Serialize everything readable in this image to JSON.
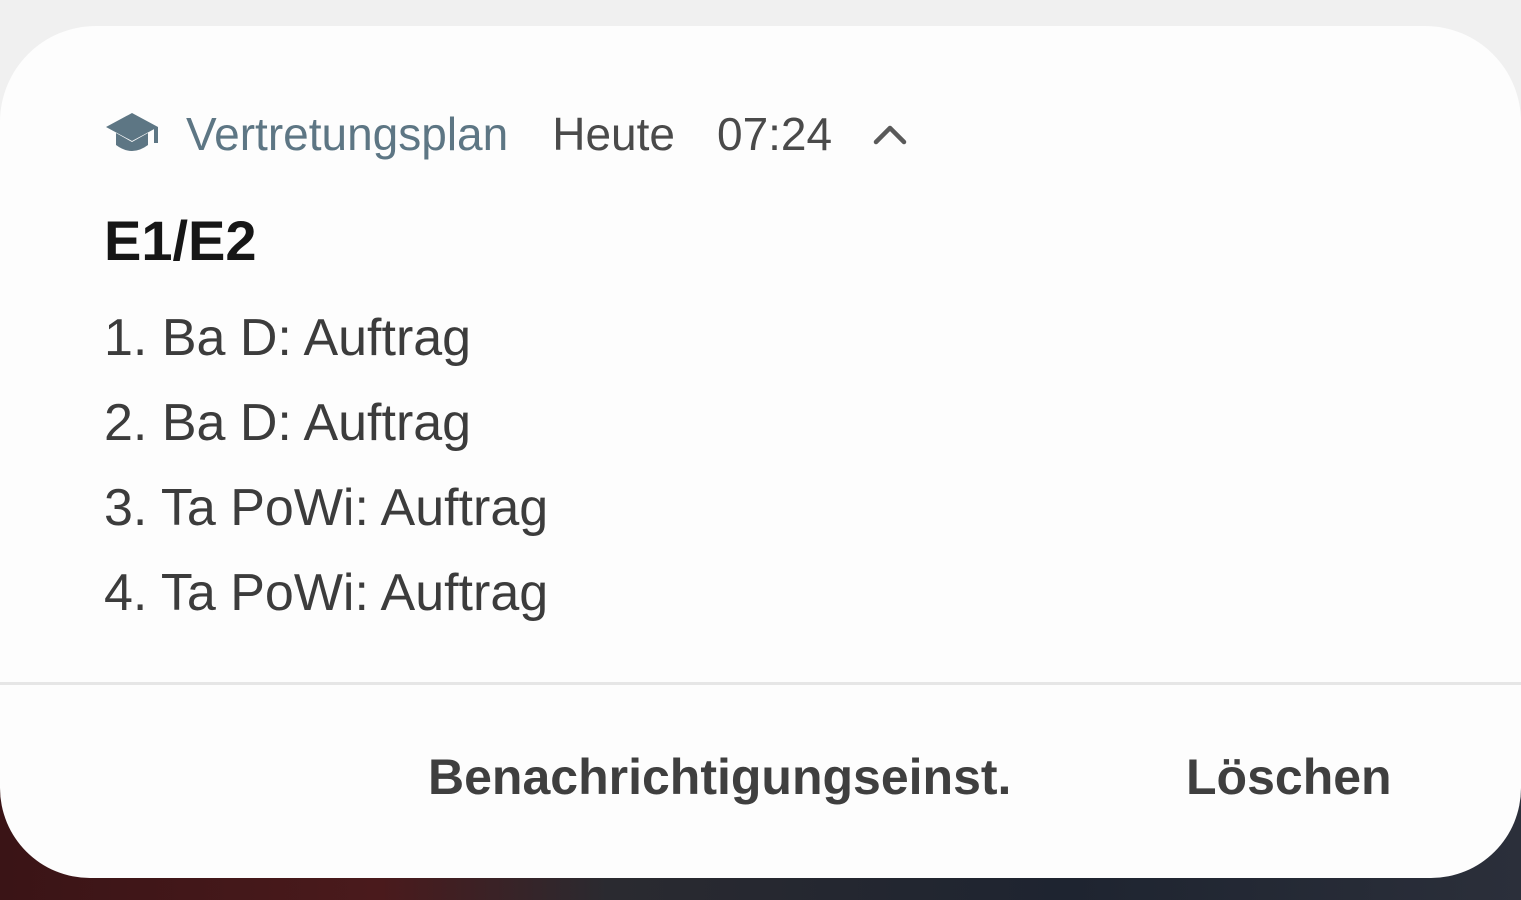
{
  "notification": {
    "app_icon": "graduation-cap-icon",
    "app_name": "Vertretungsplan",
    "when": "Heute",
    "time": "07:24",
    "expand_icon": "chevron-up-icon",
    "title": "E1/E2",
    "lines": [
      "1. Ba D: Auftrag",
      "2. Ba D: Auftrag",
      "3. Ta PoWi: Auftrag",
      "4. Ta PoWi: Auftrag"
    ],
    "actions": {
      "settings_label": "Benachrichtigungseinst.",
      "clear_label": "Löschen"
    }
  },
  "colors": {
    "app_name": "#5d7684",
    "icon": "#5d7684",
    "card_bg": "#fdfdfd",
    "title": "#161616",
    "body_text": "#3c3c3c"
  }
}
